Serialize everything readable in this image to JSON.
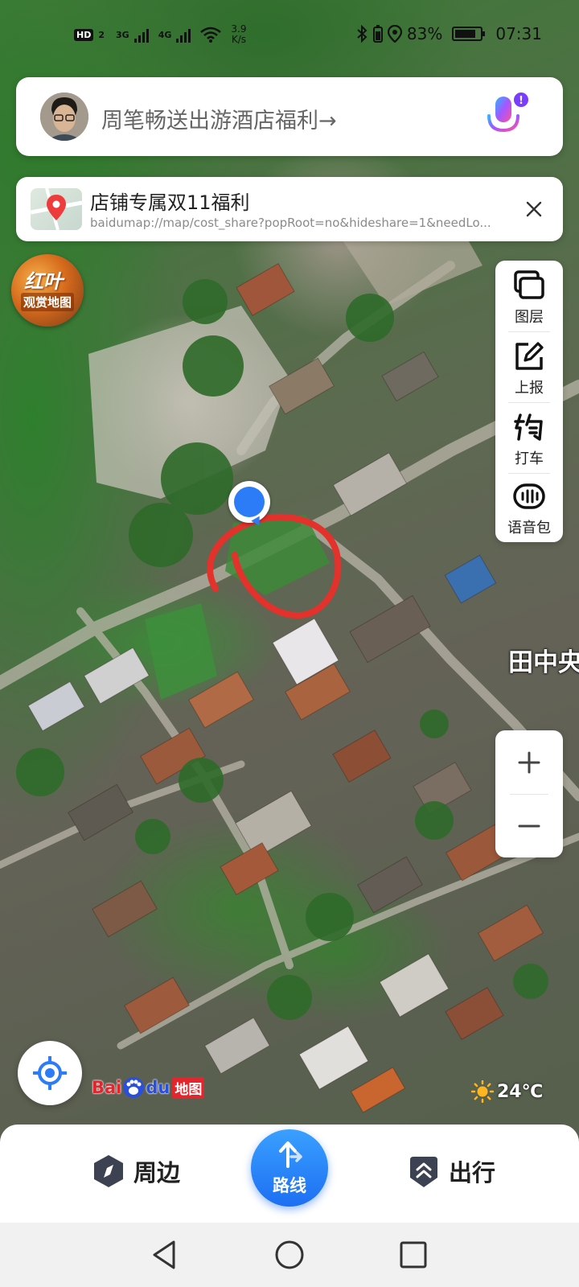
{
  "status_bar": {
    "hd_badge": "HD",
    "sim_slot": "2",
    "network1": "3G",
    "network2": "4G",
    "speed_value": "3.9",
    "speed_unit": "K/s",
    "battery_percent": "83%",
    "battery_level": 0.83,
    "time": "07:31"
  },
  "search": {
    "text": "周笔畅送出游酒店福利→",
    "voice_icon": "microphone-icon",
    "notification_dot": "!"
  },
  "promo": {
    "title": "店铺专属双11福利",
    "url": "baidumap://map/cost_share?popRoot=no&hideshare=1&needLo..."
  },
  "leaf_badge": {
    "line1": "红叶",
    "line2": "观赏地图"
  },
  "toolbar": {
    "items": [
      {
        "label": "图层",
        "icon": "layers-icon"
      },
      {
        "label": "上报",
        "icon": "report-edit-icon"
      },
      {
        "label": "打车",
        "icon": "taxi-icon"
      },
      {
        "label": "语音包",
        "icon": "voice-pack-icon"
      }
    ]
  },
  "map": {
    "place_label": "田中央",
    "marker_color": "#2b7cf6",
    "annotation_color": "#e3312b"
  },
  "zoom": {
    "in": "+",
    "out": "−"
  },
  "logo": {
    "bai": "Bai",
    "du": "du",
    "ditu": "地图"
  },
  "weather": {
    "temperature": "24℃",
    "icon": "sun-icon"
  },
  "bottom_nav": {
    "nearby": "周边",
    "route": "路线",
    "travel": "出行"
  },
  "colors": {
    "accent": "#1d6ff2",
    "brand_red": "#e3262d"
  }
}
